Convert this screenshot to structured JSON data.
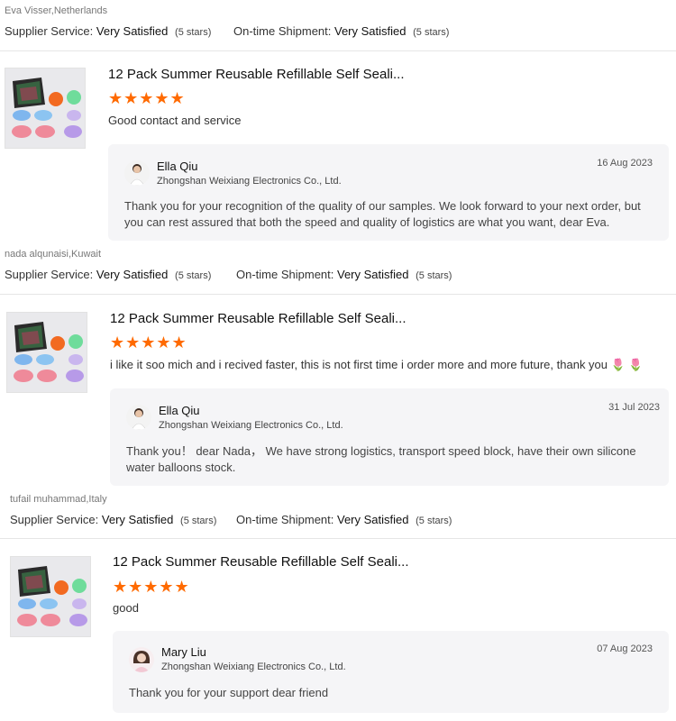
{
  "reviews": [
    {
      "buyer": "Eva Visser,Netherlands",
      "supplier_service_label": "Supplier Service:",
      "supplier_service_value": "Very Satisfied",
      "supplier_service_stars": "(5 stars)",
      "shipment_label": "On-time Shipment:",
      "shipment_value": "Very Satisfied",
      "shipment_stars": "(5 stars)",
      "product_title": "12 Pack Summer Reusable Refillable Self Seali...",
      "rating": 5,
      "stars": "★★★★★",
      "comment": "Good contact and service",
      "reply": {
        "name": "Ella Qiu",
        "company": "Zhongshan Weixiang Electronics Co., Ltd.",
        "date": "16 Aug 2023",
        "text": "Thank you for your recognition of the quality of our samples. We look forward to your next order, but you can rest assured that both the speed and quality of logistics are what you want, dear Eva."
      }
    },
    {
      "buyer": "nada alqunaisi,Kuwait",
      "supplier_service_label": "Supplier Service:",
      "supplier_service_value": "Very Satisfied",
      "supplier_service_stars": "(5 stars)",
      "shipment_label": "On-time Shipment:",
      "shipment_value": "Very Satisfied",
      "shipment_stars": "(5 stars)",
      "product_title": "12 Pack Summer Reusable Refillable Self Seali...",
      "rating": 5,
      "stars": "★★★★★",
      "comment": "i like it soo mich and i recived faster, this is not first time i order more and more future, thank you 🌷 🌷",
      "reply": {
        "name": "Ella Qiu",
        "company": "Zhongshan Weixiang Electronics Co., Ltd.",
        "date": "31 Jul 2023",
        "text": "Thank you！ dear Nada， We have strong logistics, transport speed block, have their own silicone water balloons stock."
      }
    },
    {
      "buyer": "tufail muhammad,Italy",
      "supplier_service_label": "Supplier Service:",
      "supplier_service_value": "Very Satisfied",
      "supplier_service_stars": "(5 stars)",
      "shipment_label": "On-time Shipment:",
      "shipment_value": "Very Satisfied",
      "shipment_stars": "(5 stars)",
      "product_title": "12 Pack Summer Reusable Refillable Self Seali...",
      "rating": 5,
      "stars": "★★★★★",
      "comment": "good",
      "reply": {
        "name": "Mary Liu",
        "company": "Zhongshan Weixiang Electronics Co., Ltd.",
        "date": "07 Aug 2023",
        "text": "Thank you for your support dear friend"
      }
    }
  ],
  "colors": {
    "star": "#ff6a00",
    "reply_bg": "#f5f5f7"
  },
  "icons": {
    "product_thumbnail": "water-balloons-mesh-bag-image",
    "avatar_male": "man-in-white-shirt-avatar",
    "avatar_female": "woman-avatar"
  }
}
